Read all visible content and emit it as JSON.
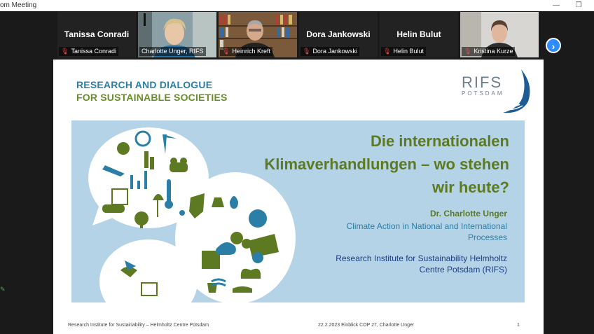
{
  "window": {
    "title": "om Meeting",
    "minimize": "—",
    "restore": "❐"
  },
  "participants": [
    {
      "name": "Tanissa Conradi",
      "video": false
    },
    {
      "name": "Charlotte Unger, RIFS",
      "video": true,
      "speaking": true
    },
    {
      "name": "Heinrich Kreft",
      "video": true
    },
    {
      "name": "Dora Jankowski",
      "video": false
    },
    {
      "name": "Helin Bulut",
      "video": false
    },
    {
      "name": "Kristina Kurze",
      "video": true
    }
  ],
  "gallery": {
    "next_icon": "›"
  },
  "slide": {
    "brand_line1": "RESEARCH AND DIALOGUE",
    "brand_line2": "FOR SUSTAINABLE SOCIETIES",
    "logo_main": "RIFS",
    "logo_sub": "POTSDAM",
    "headline_line1": "Die internationalen",
    "headline_line2": "Klimaverhandlungen – wo stehen",
    "headline_line3": "wir heute?",
    "author": "Dr. Charlotte Unger",
    "subtitle_line1": "Climate Action in National and International",
    "subtitle_line2": "Processes",
    "institute_line1": "Research Institute for Sustainability Helmholtz",
    "institute_line2": "Centre Potsdam (RIFS)",
    "footer_left": "Research Institute for Sustainability – Helmholtz Centre Potsdam",
    "footer_center": "22.2.2023 Einblick COP 27, Charlotte Unger",
    "footer_page": "1"
  },
  "colors": {
    "accent": "#2d8cff",
    "speaking": "#7ac142",
    "slide_green": "#5d7a22",
    "slide_blue": "#2b7fa6"
  }
}
